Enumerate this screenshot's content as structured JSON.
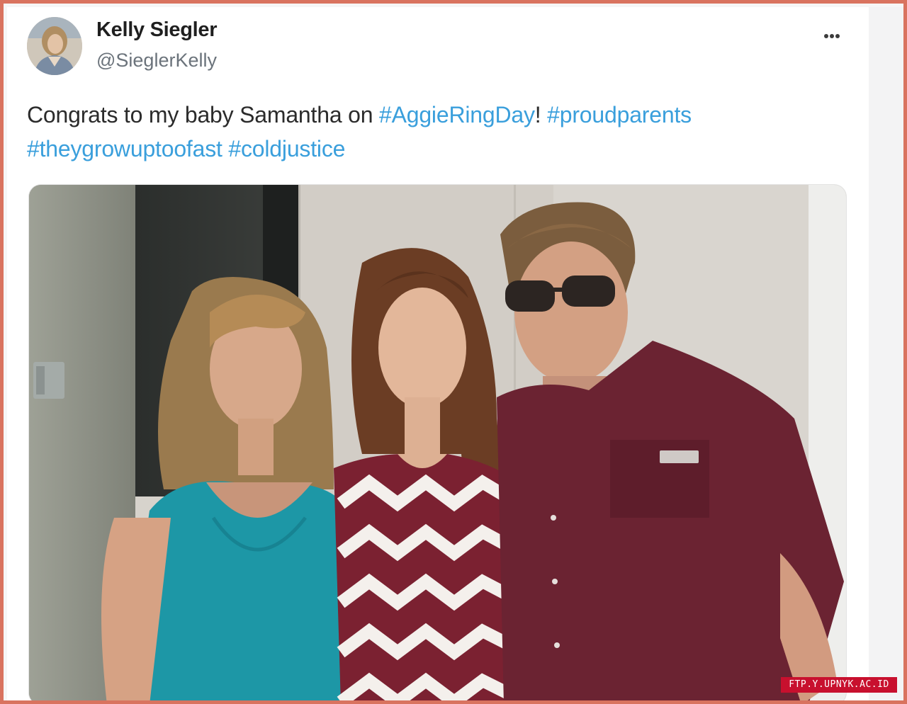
{
  "post": {
    "author": {
      "display_name": "Kelly Siegler",
      "handle": "@SieglerKelly",
      "avatar_icon": "user-avatar"
    },
    "more_icon": "more-horizontal-icon",
    "text": {
      "part1": "Congrats to my baby Samantha on ",
      "hashtag1": "#AggieRingDay",
      "part2": "! ",
      "hashtag2": "#proudparents",
      "hashtag3": "#theygrowuptoofast",
      "hashtag4": "#coldjustice"
    },
    "media_description_icon": "photo"
  },
  "watermark": "FTP.Y.UPNYK.AC.ID",
  "colors": {
    "hashtag": "#3a9fdc",
    "frame_border": "#d9735f",
    "watermark_bg": "#c8102e"
  }
}
